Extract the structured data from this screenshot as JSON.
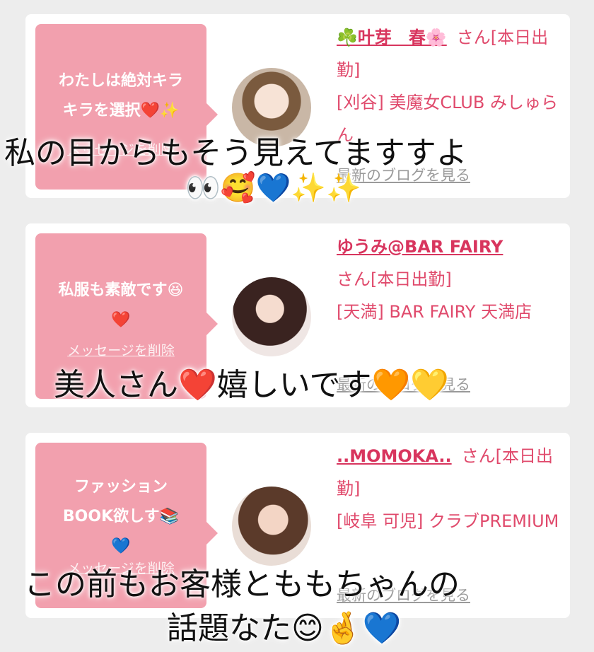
{
  "cards": [
    {
      "bubble_text": "わたしは絶対キラ\nキラを選択❤️✨",
      "delete_label": "メッセージを削除",
      "name": "☘️叶芽　春🌸",
      "san": "さん[本日出勤]",
      "shop": "[刈谷] 美魔女CLUB みしゅらん",
      "blog_label": "最新のブログを見る"
    },
    {
      "bubble_text": "私服も素敵です😆\n❤️",
      "delete_label": "メッセージを削除",
      "name": "ゆうみ@BAR FAIRY",
      "san": "さん[本日出勤]",
      "shop": "[天満] BAR FAIRY 天満店",
      "blog_label": "最新のブログを見る"
    },
    {
      "bubble_text": "ファッション\nBOOK欲しす📚\n💙",
      "delete_label": "メッセージを削除",
      "name": "..MOMOKA..",
      "san": "さん[本日出勤]",
      "shop": "[岐阜 可児] クラブPREMIUM",
      "blog_label": "最新のブログを見る"
    }
  ],
  "captions": {
    "c1": "私の目からもそう見えてますすよ",
    "c1_emoji": "👀🥰💙✨✨",
    "c2": "美人さん❤️嬉しいです🧡💛",
    "c3": "この前もお客様とももちゃんの",
    "c3b": "話題なた😊🤞💙"
  }
}
